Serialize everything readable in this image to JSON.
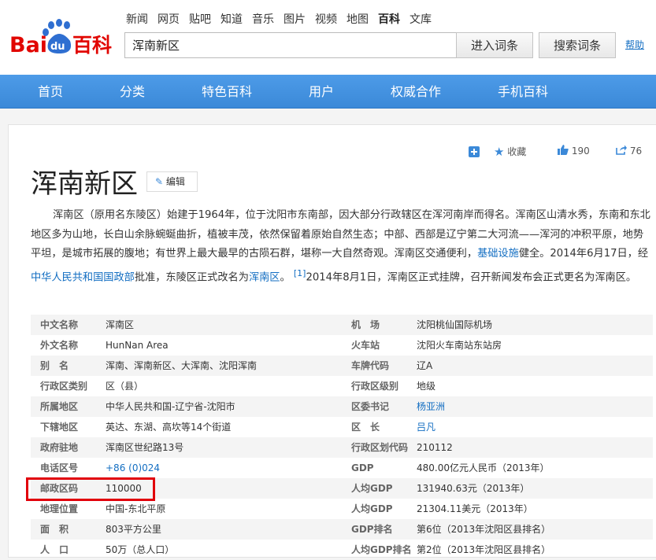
{
  "header": {
    "top_links": [
      "新闻",
      "网页",
      "贴吧",
      "知道",
      "音乐",
      "图片",
      "视频",
      "地图",
      "百科",
      "文库"
    ],
    "active_link": "百科",
    "search_value": "浑南新区",
    "enter_button": "进入词条",
    "search_button": "搜索词条",
    "help_link": "帮助",
    "logo": {
      "text_bai": "Bai",
      "text_du": "du",
      "text_baike": "百科"
    }
  },
  "nav": {
    "items": [
      "首页",
      "分类",
      "特色百科",
      "用户",
      "权威合作",
      "手机百科"
    ]
  },
  "tools": {
    "collect_label": "收藏",
    "like_count": "190",
    "share_count": "76"
  },
  "article": {
    "title": "浑南新区",
    "edit_label": "编辑",
    "summary": {
      "p1": "浑南区（原用名东陵区）始建于1964年，位于沈阳市东南部，因大部分行政辖区在浑河南岸而得名。浑南区山清水秀，东南和东北地区多为山地，长白山余脉蜿蜒曲折，植被丰茂，依然保留着原始自然生态；中部、西部是辽宁第二大河流——浑河的冲积平原，地势平坦，是城市拓展的腹地；有世界上最大最早的古陨石群，堪称一大自然奇观。浑南区交通便利，",
      "link1": "基础设施",
      "p2": "健全。2014年6月17日，经",
      "link2": "中华人民共和国国政部",
      "p3": "批准，东陵区正式改名为",
      "link3": "浑南区",
      "p4": "。",
      "ref": "[1]",
      "p5": "2014年8月1日，浑南区正式挂牌，召开新闻发布会正式更名为浑南区。"
    }
  },
  "infobox": {
    "rows": [
      {
        "l1": "中文名称",
        "v1": "浑南区",
        "l2": "机　场",
        "v2": "沈阳桃仙国际机场"
      },
      {
        "l1": "外文名称",
        "v1": "HunNan Area",
        "l2": "火车站",
        "v2": "沈阳火车南站东站房"
      },
      {
        "l1": "别　名",
        "v1": "浑南、浑南新区、大浑南、沈阳浑南",
        "l2": "车牌代码",
        "v2": "辽A"
      },
      {
        "l1": "行政区类别",
        "v1": "区（县）",
        "l2": "行政区级别",
        "v2": "地级"
      },
      {
        "l1": "所属地区",
        "v1": "中华人民共和国-辽宁省-沈阳市",
        "l2": "区委书记",
        "v2": "杨亚洲"
      },
      {
        "l1": "下辖地区",
        "v1": "英达、东湖、高坎等14个街道",
        "l2": "区　长",
        "v2": "吕凡"
      },
      {
        "l1": "政府驻地",
        "v1": "浑南区世纪路13号",
        "l2": "行政区划代码",
        "v2": "210112"
      },
      {
        "l1": "电话区号",
        "v1": "+86 (0)024",
        "l2": "GDP",
        "v2": "480.00亿元人民币（2013年）"
      },
      {
        "l1": "邮政区码",
        "v1": "110000",
        "l2": "人均GDP",
        "v2": "131940.63元（2013年）"
      },
      {
        "l1": "地理位置",
        "v1": "中国-东北平原",
        "l2": "人均GDP",
        "v2": "21304.11美元（2013年）"
      },
      {
        "l1": "面　积",
        "v1": "803平方公里",
        "l2": "GDP排名",
        "v2": "第6位（2013年沈阳区县排名）"
      },
      {
        "l1": "人　口",
        "v1": "50万（总人口）",
        "l2": "人均GDP排名",
        "v2": "第2位（2013年沈阳区县排名）"
      }
    ]
  },
  "colors": {
    "brand_blue": "#2f6fd1",
    "brand_red": "#e10601",
    "nav_blue": "#3b89d8",
    "link": "#136ec2",
    "highlight": "#e1000a"
  }
}
